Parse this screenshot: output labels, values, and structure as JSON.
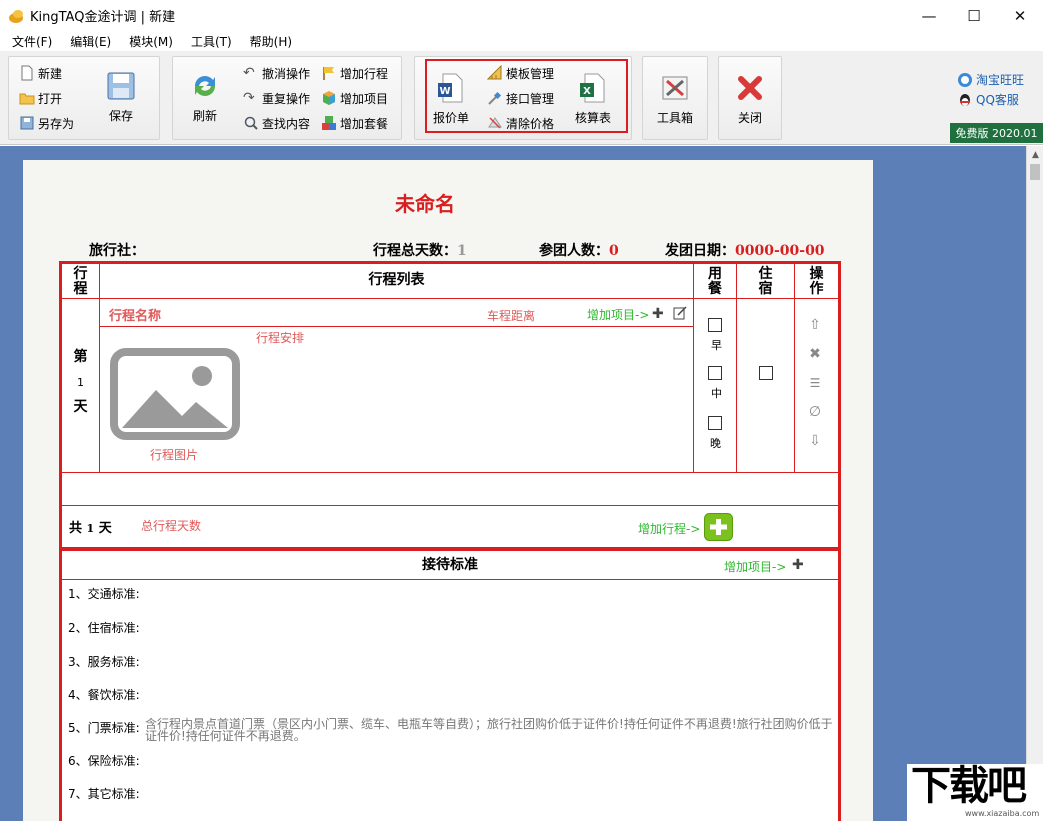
{
  "window": {
    "title": "KingTAQ金途计调 | 新建",
    "controls": [
      "—",
      "☐",
      "✕"
    ]
  },
  "menu": [
    "文件(F)",
    "编辑(E)",
    "模块(M)",
    "工具(T)",
    "帮助(H)"
  ],
  "toolbar": {
    "file": {
      "new": "新建",
      "open": "打开",
      "save_as": "另存为",
      "save": "保存"
    },
    "edit": {
      "refresh": "刷新",
      "undo": "撤消操作",
      "redo": "重复操作",
      "find": "查找内容",
      "add_trip": "增加行程",
      "add_item": "增加项目",
      "add_package": "增加套餐"
    },
    "docs": {
      "quote": "报价单",
      "template": "模板管理",
      "api": "接口管理",
      "clear_price": "清除价格",
      "account": "核算表"
    },
    "tools": "工具箱",
    "close": "关闭",
    "taobao": "淘宝旺旺",
    "qq": "QQ客服",
    "version": "免费版 2020.01"
  },
  "doc": {
    "title": "未命名",
    "agency_label": "旅行社：",
    "total_days_label": "行程总天数：",
    "total_days": "1",
    "people_label": "参团人数：",
    "people": "0",
    "date_label": "发团日期：",
    "date": "0000-00-00"
  },
  "itinerary": {
    "col_day": "行\n程",
    "col_list": "行程列表",
    "col_meal": "用\n餐",
    "col_stay": "住\n宿",
    "col_ops": "操\n作",
    "day_label": [
      "第",
      "1",
      "天"
    ],
    "trip_name": "行程名称",
    "distance": "车程距离",
    "add_item": "增加项目->",
    "arrangement": "行程安排",
    "image_label": "行程图片",
    "meals": [
      "早",
      "中",
      "晚"
    ],
    "total_prefix": "共",
    "total_value": "1",
    "total_suffix": "天",
    "total_days_hint": "总行程天数",
    "add_trip": "增加行程->"
  },
  "standards": {
    "title": "接待标准",
    "add_item": "增加项目->",
    "items": [
      "1、交通标准:",
      "2、住宿标准:",
      "3、服务标准:",
      "4、餐饮标准:",
      "5、门票标准:",
      "6、保险标准:",
      "7、其它标准:"
    ],
    "ticket_desc": "含行程内景点首道门票（景区内小门票、缆车、电瓶车等自费）；旅行社团购价低于证件价!持任何证件不再退费!旅行社团购价低于证件价!持任何证件不再退费。"
  },
  "watermark": "下载吧",
  "watermark_url": "www.xiazaiba.com"
}
